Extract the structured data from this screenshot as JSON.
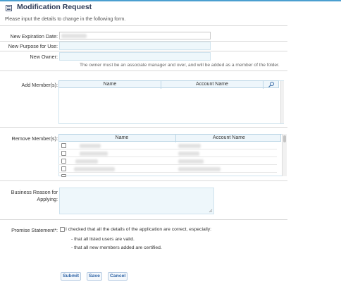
{
  "header": {
    "title": "Modification Request",
    "icon": "form-icon",
    "subtitle": "Please input the details to change in the following form."
  },
  "fields": {
    "expiration_label": "New Expiration Date:",
    "purpose_label": "New Purpose for Use:",
    "owner_label": "New Owner:",
    "owner_note": "The owner must be an associate manager and over, and will be added as a member of the folder."
  },
  "add_members": {
    "label": "Add Member(s):",
    "columns": [
      "Name",
      "Account Name"
    ],
    "search_icon": "search-icon"
  },
  "remove_members": {
    "label": "Remove Member(s):",
    "columns": [
      "Name",
      "Account Name"
    ]
  },
  "business_reason": {
    "label_line1": "Business Reason for",
    "label_line2": "Applying:"
  },
  "promise": {
    "label": "Promise Statement*:",
    "statement": "I checked that all the details of the application are correct, especially:",
    "bullet1": "- that all listed users are valid.",
    "bullet2": "- that all new members added are certified."
  },
  "buttons": {
    "submit": "Submit",
    "save": "Save",
    "cancel": "Cancel"
  },
  "colors": {
    "accent": "#4a9fd0",
    "title": "#2f3c58",
    "input_bg": "#eef7fb",
    "button_text": "#2f64a6"
  }
}
